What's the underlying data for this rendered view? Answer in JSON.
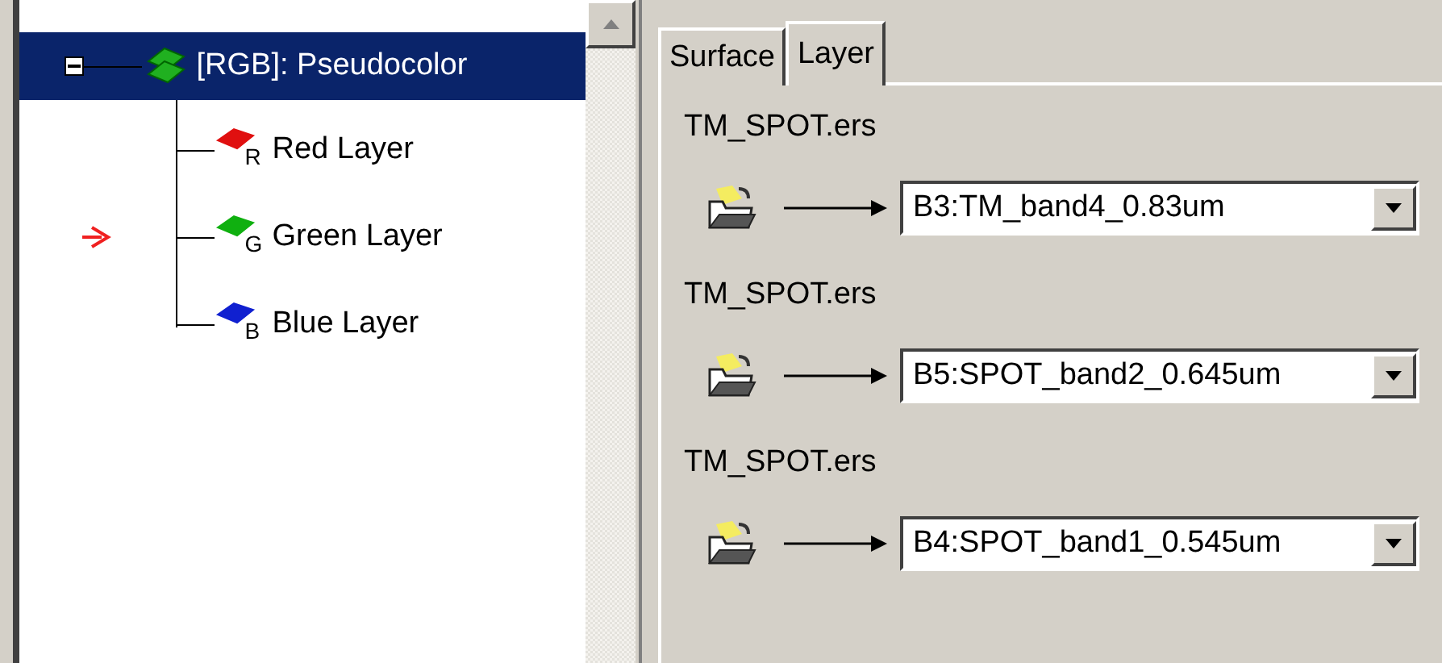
{
  "tree": {
    "root": {
      "label": "[RGB]: Pseudocolor",
      "selected": true,
      "expanded": true
    },
    "children": [
      {
        "label": "Red Layer",
        "badge": "R",
        "color": "#e01010",
        "pointer": false
      },
      {
        "label": "Green Layer",
        "badge": "G",
        "color": "#10b010",
        "pointer": true
      },
      {
        "label": "Blue Layer",
        "badge": "B",
        "color": "#1020d0",
        "pointer": false
      }
    ]
  },
  "tabs": [
    {
      "label": "Surface",
      "selected": false
    },
    {
      "label": "Layer",
      "selected": true
    }
  ],
  "layers": [
    {
      "file": "TM_SPOT.ers",
      "band": "B3:TM_band4_0.83um"
    },
    {
      "file": "TM_SPOT.ers",
      "band": "B5:SPOT_band2_0.645um"
    },
    {
      "file": "TM_SPOT.ers",
      "band": "B4:SPOT_band1_0.545um"
    }
  ]
}
